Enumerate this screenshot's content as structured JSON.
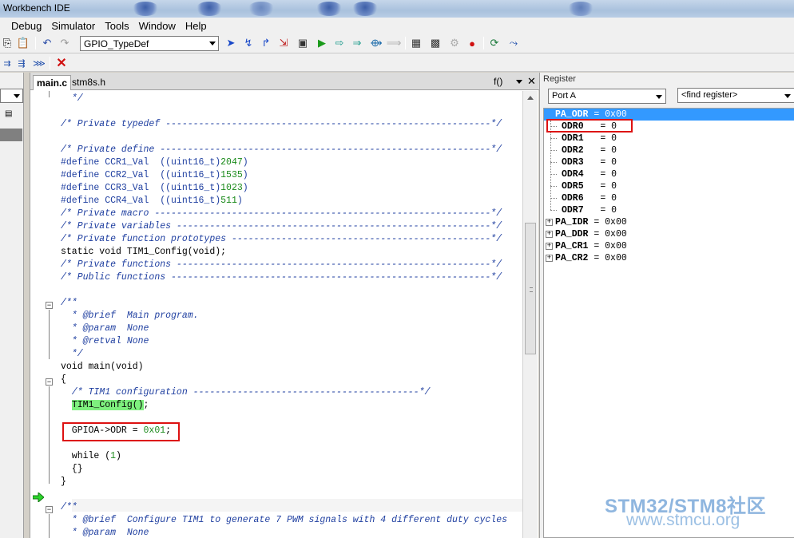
{
  "window": {
    "title": "Workbench IDE"
  },
  "menu": [
    "Debug",
    "Simulator",
    "Tools",
    "Window",
    "Help"
  ],
  "toolbar": {
    "function_combo": "GPIO_TypeDef",
    "icons": [
      "copy-icon",
      "paste-icon",
      "undo-icon",
      "redo-icon",
      "step-into-icon",
      "step-over-icon",
      "step-out-icon",
      "run-to-cursor-icon",
      "disassembly-icon",
      "go-icon",
      "step-icon",
      "next-icon",
      "step-instr-icon",
      "next-instr-icon",
      "memory-icon",
      "register-icon",
      "peripheral-icon",
      "stop-icon",
      "restart-icon",
      "reset-icon"
    ],
    "row2_icons": [
      "breakpoint-icon",
      "break-all-icon",
      "clear-breakpoints-icon",
      "delete-icon"
    ]
  },
  "editor": {
    "tabs": [
      "main.c",
      "stm8s.h"
    ],
    "function_indicator": "f()",
    "lines": [
      {
        "text": "  */",
        "cls": "cm"
      },
      {
        "text": "",
        "cls": ""
      },
      {
        "text": "/* Private typedef -----------------------------------------------------------*/",
        "cls": "cm"
      },
      {
        "text": "",
        "cls": ""
      },
      {
        "text": "/* Private define ------------------------------------------------------------*/",
        "cls": "cm"
      },
      {
        "text": "#define CCR1_Val  ((uint16_t)2047)",
        "cls": "pp"
      },
      {
        "text": "#define CCR2_Val  ((uint16_t)1535)",
        "cls": "pp"
      },
      {
        "text": "#define CCR3_Val  ((uint16_t)1023)",
        "cls": "pp"
      },
      {
        "text": "#define CCR4_Val  ((uint16_t)511)",
        "cls": "pp"
      },
      {
        "text": "/* Private macro -------------------------------------------------------------*/",
        "cls": "cm"
      },
      {
        "text": "/* Private variables ---------------------------------------------------------*/",
        "cls": "cm"
      },
      {
        "text": "/* Private function prototypes -----------------------------------------------*/",
        "cls": "cm"
      },
      {
        "text": "static void TIM1_Config(void);",
        "cls": ""
      },
      {
        "text": "/* Private functions ---------------------------------------------------------*/",
        "cls": "cm"
      },
      {
        "text": "/* Public functions ----------------------------------------------------------*/",
        "cls": "cm"
      },
      {
        "text": "",
        "cls": ""
      },
      {
        "text": "/**",
        "cls": "cm"
      },
      {
        "text": "  * @brief  Main program.",
        "cls": "cm"
      },
      {
        "text": "  * @param  None",
        "cls": "cm"
      },
      {
        "text": "  * @retval None",
        "cls": "cm"
      },
      {
        "text": "  */",
        "cls": "cm"
      },
      {
        "text": "void main(void)",
        "cls": ""
      },
      {
        "text": "{",
        "cls": ""
      },
      {
        "text": "  /* TIM1 configuration -----------------------------------------*/",
        "cls": "cm"
      },
      {
        "text": "  TIM1_Config();",
        "cls": "hlline"
      },
      {
        "text": "",
        "cls": ""
      },
      {
        "text": "  GPIOA->ODR = 0x01;",
        "cls": "odr"
      },
      {
        "text": "",
        "cls": ""
      },
      {
        "text": "  while (1)",
        "cls": "while"
      },
      {
        "text": "  {}",
        "cls": ""
      },
      {
        "text": "}",
        "cls": ""
      },
      {
        "text": "",
        "cls": ""
      },
      {
        "text": "/**",
        "cls": "cm"
      },
      {
        "text": "  * @brief  Configure TIM1 to generate 7 PWM signals with 4 different duty cycles",
        "cls": "cm"
      },
      {
        "text": "  * @param  None",
        "cls": "cm"
      }
    ]
  },
  "register_panel": {
    "title": "Register",
    "port_combo": "Port A",
    "find_combo": "<find register>",
    "rows": [
      {
        "name": "PA_ODR",
        "value": "0x00",
        "level": 0,
        "expander": "minus",
        "selected": true
      },
      {
        "name": "ODR0",
        "value": "0",
        "level": 1,
        "expander": "",
        "selected": false
      },
      {
        "name": "ODR1",
        "value": "0",
        "level": 1,
        "expander": "",
        "selected": false
      },
      {
        "name": "ODR2",
        "value": "0",
        "level": 1,
        "expander": "",
        "selected": false
      },
      {
        "name": "ODR3",
        "value": "0",
        "level": 1,
        "expander": "",
        "selected": false
      },
      {
        "name": "ODR4",
        "value": "0",
        "level": 1,
        "expander": "",
        "selected": false
      },
      {
        "name": "ODR5",
        "value": "0",
        "level": 1,
        "expander": "",
        "selected": false
      },
      {
        "name": "ODR6",
        "value": "0",
        "level": 1,
        "expander": "",
        "selected": false
      },
      {
        "name": "ODR7",
        "value": "0",
        "level": 1,
        "expander": "",
        "selected": false
      },
      {
        "name": "PA_IDR",
        "value": "0x00",
        "level": 0,
        "expander": "plus",
        "selected": false
      },
      {
        "name": "PA_DDR",
        "value": "0x00",
        "level": 0,
        "expander": "plus",
        "selected": false
      },
      {
        "name": "PA_CR1",
        "value": "0x00",
        "level": 0,
        "expander": "plus",
        "selected": false
      },
      {
        "name": "PA_CR2",
        "value": "0x00",
        "level": 0,
        "expander": "plus",
        "selected": false
      }
    ]
  },
  "watermark": {
    "line1": "STM32/STM8社区",
    "line2": "www.stmcu.org"
  },
  "colors": {
    "selection": "#3399ff",
    "highlight": "#7ef07e",
    "annotation_red": "#dd1111",
    "comment": "#1f3fa0",
    "number": "#1a8a1a"
  }
}
